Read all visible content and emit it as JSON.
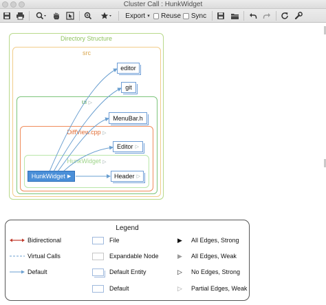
{
  "window": {
    "title": "Cluster Call : HunkWidget"
  },
  "toolbar": {
    "export_label": "Export",
    "reuse_label": "Reuse",
    "sync_label": "Sync"
  },
  "graph": {
    "clusters": {
      "directory": "Directory Structure",
      "src": "src",
      "ui": "ui",
      "diffview": "DiffView.cpp",
      "hunkwidget": "HunkWidget"
    },
    "nodes": {
      "editor_dir": "editor",
      "git": "git",
      "menubar": "MenuBar.h",
      "editor": "Editor",
      "header": "Header",
      "hunkwidget": "HunkWidget"
    }
  },
  "legend": {
    "title": "Legend",
    "col1": [
      "Bidirectional",
      "Virtual Calls",
      "Default"
    ],
    "col2": [
      "File",
      "Expandable Node",
      "Default Entity",
      "Default"
    ],
    "col3": [
      "All Edges, Strong",
      "All Edges, Weak",
      "No Edges, Strong",
      "Partial Edges, Weak"
    ]
  },
  "colors": {
    "directory": "#b8d98a",
    "src": "#f1cc8a",
    "ui": "#7cc47a",
    "diffview": "#ef8b5a",
    "hunk_cluster": "#b9e6a8",
    "node_border": "#6d9dd6",
    "focus": "#4a8fd8",
    "edge": "#6a9fd0",
    "bidirectional": "#c0392b"
  }
}
